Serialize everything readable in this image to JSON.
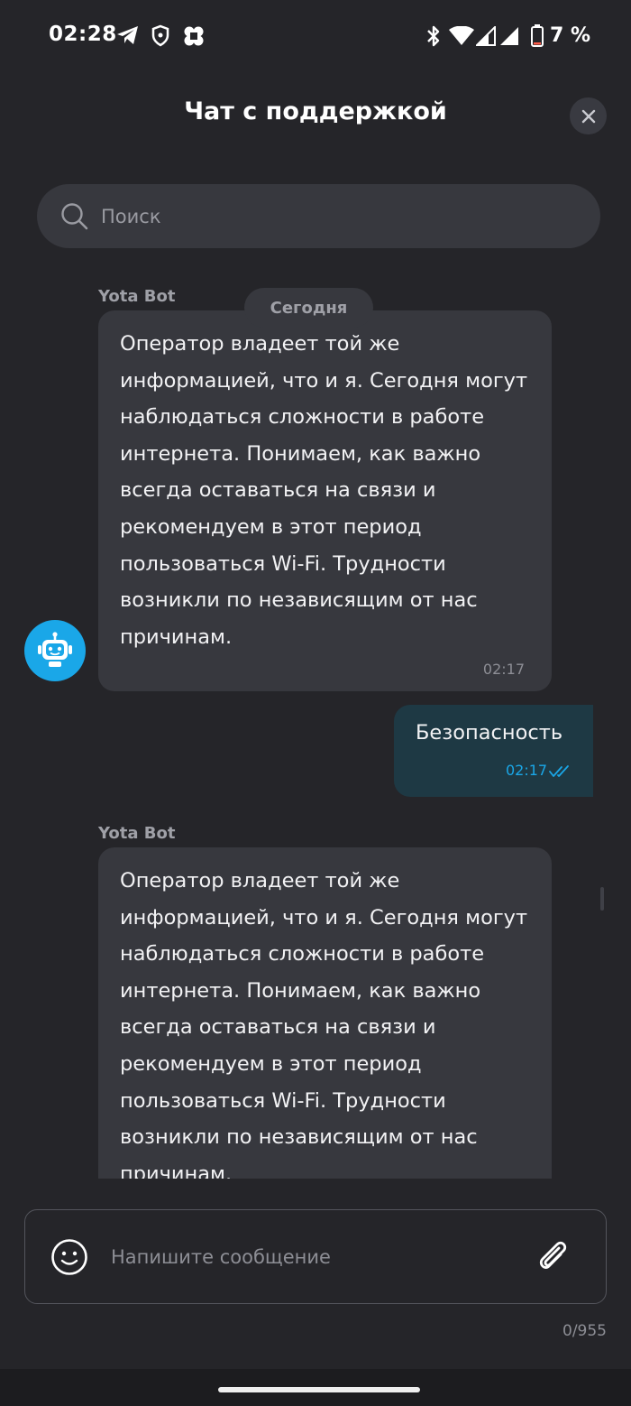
{
  "status_bar": {
    "time": "02:28",
    "battery_text": "7 %",
    "icons": [
      "telegram-icon",
      "shield-icon",
      "app-icon",
      "bluetooth-icon",
      "wifi-icon",
      "signal-icon",
      "signal-icon",
      "battery-icon"
    ]
  },
  "header": {
    "title": "Чат с поддержкой"
  },
  "search": {
    "placeholder": "Поиск",
    "value": ""
  },
  "chat": {
    "date_separator": "Сегодня",
    "messages": [
      {
        "direction": "incoming",
        "sender": "Yota Bot",
        "text": "Оператор владеет той же информацией, что и я. Сегодня могут наблюдаться сложности в работе интернета. Понимаем, как важно всегда оставаться на связи и рекомендуем в этот период пользоваться Wi-Fi. Трудности возникли по независящим от нас причинам.",
        "time": "02:17"
      },
      {
        "direction": "outgoing",
        "text": "Безопасность",
        "time": "02:17",
        "status": "read"
      },
      {
        "direction": "incoming",
        "sender": "Yota Bot",
        "text": "Оператор владеет той же информацией, что и я. Сегодня могут наблюдаться сложности в работе интернета. Понимаем, как важно всегда оставаться на связи и рекомендуем в этот период пользоваться Wi-Fi. Трудности возникли по независящим от нас причинам."
      }
    ]
  },
  "composer": {
    "placeholder": "Напишите сообщение",
    "value": "",
    "counter": "0/955"
  },
  "colors": {
    "background": "#252529",
    "bubble_incoming": "#37383e",
    "bubble_outgoing": "#1e3944",
    "accent": "#1aa7e8",
    "muted_text": "#8d8e95"
  }
}
